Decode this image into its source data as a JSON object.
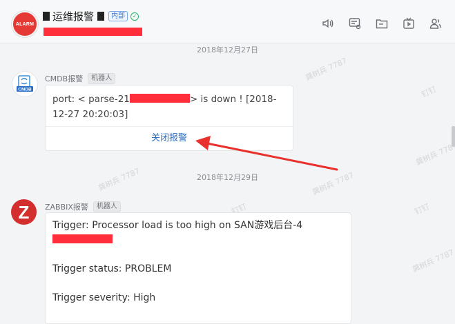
{
  "header": {
    "avatar_text": "ALARM",
    "title": "运维报警",
    "internal_tag": "内部",
    "verified_glyph": "✓"
  },
  "toolbar": {
    "icons": [
      "speaker-icon",
      "message-settings-icon",
      "folder-icon",
      "tv-icon",
      "members-icon"
    ]
  },
  "messages": [
    {
      "date": "2018年12月27日",
      "sender": "CMDB报警",
      "bot_tag": "机器人",
      "avatar_text": "CMDB",
      "text_part1": "port: < parse-21",
      "text_part2": "> is down ! [2018-12-27 20:20:03]",
      "action_label": "关闭报警"
    },
    {
      "date": "2018年12月29日",
      "sender": "ZABBIX报警",
      "bot_tag": "机器人",
      "avatar_text": "Z",
      "line1": "Trigger: Processor load is too high on SAN游戏后台-4",
      "line2": "Trigger status: PROBLEM",
      "line3": "Trigger severity: High"
    }
  ],
  "watermarks": [
    "龚树兵 7787",
    "钉钉"
  ],
  "colors": {
    "accent_link": "#2c6fc2",
    "alarm_red": "#e53935",
    "redaction": "#ff2e3a"
  }
}
